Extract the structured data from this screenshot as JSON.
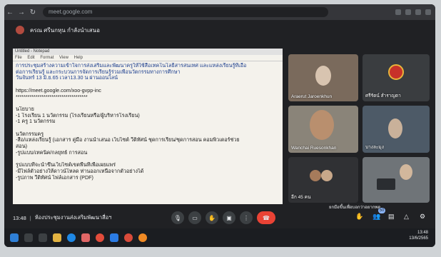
{
  "browser": {
    "url": "meet.google.com"
  },
  "header": {
    "presenter_label": "ครณ ศรีนกหุน กำลังนำเสนอ"
  },
  "doc": {
    "window_title": "Untitled - Notepad",
    "menu": [
      "File",
      "Edit",
      "Format",
      "View",
      "Help"
    ],
    "lines": [
      "การประชุมสร้างความเข้าใจการส่งเสริมและพัฒนาครูให้ใช้สื่อเทคโนโลยีสารสนเทศ และแหล่งเรียนรู้ที่เอื้อ",
      "ต่อการเรียนรู้ และกระบวนการจัดการเรียนรู้ร่วมเพื่อนวัตกรรมทางการศึกษา",
      "วันจันทร์ 13 มิ.ย.65 เวลา13.30 น ผ่านออนไลน์",
      "",
      "https://meet.google.com/xoo-gvpp-inc",
      "************************************",
      "",
      "นโยบาย",
      "-1 โรงเรียน 1 นวัตกรรม (โรงเรียนหรือ/ผู้บริหารโรงเรียน)",
      "-1 ครู 1 นวัตกรรม",
      "",
      "นวัตกรรมครู",
      "-สื่อ/แหล่งเรียนรู้ (เอกสาร คู่มือ งานนำเสนอ เว็บไซต์ วีดิทัศน์ ชุดการเรียน/ชุดการสอน คอมพิวเตอร์ช่วย",
      "สอน)",
      "-รูปแบบ/เทคนิค/กลยุทธ์ การสอน",
      "",
      "รูปแบบที่จะนำขึ้นเว็บไซต์เขตพื้นที่เพื่อเผยแพร่",
      "-มีไฟล์ตัวอย่างให้ดาวน์โหลด ท่านออกเหนือจากตัวอย่างได้",
      "-รูปภาพ วีดิทัศน์ ไฟล์เอกสาร (PDF)"
    ]
  },
  "tiles": [
    {
      "name": "Araerut Jaroenkhun"
    },
    {
      "name": "ศรีรัตน์ สำราญตา"
    },
    {
      "name": "Wanchai Ruesonkhan"
    },
    {
      "name": "บางละมุง"
    },
    {
      "name": "อีก 45 คน"
    },
    {
      "name": ""
    }
  ],
  "tooltip": "ยกมือขึ้นเพื่อบอกว่าอยากพูด",
  "bottom": {
    "time": "13:48",
    "separator": "|",
    "meeting_name": "ห้องประชุมงานส่งเสริมพัฒนาสื่อฯ",
    "people_count": "50"
  },
  "clock": {
    "time": "13:48",
    "date": "13/6/2565"
  },
  "colors": {
    "hangup": "#ea4335",
    "meet_bg": "#202124",
    "accent": "#8ab4f8"
  }
}
